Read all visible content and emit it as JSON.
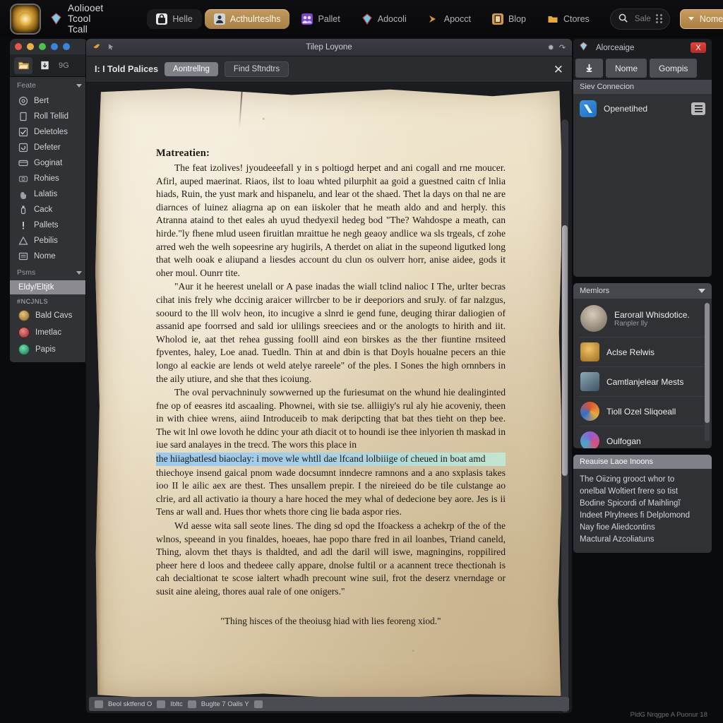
{
  "topbar": {
    "logo_icon": "sun-emblem-logo",
    "title_icon": "gem-icon",
    "app_title": "Aoliooet Tcool Tcall",
    "tabs": [
      {
        "label": "Helle",
        "icon": "lock-icon",
        "active": false,
        "style": "dark"
      },
      {
        "label": "Acthulrteslhs",
        "icon": "person-card-icon",
        "active": true,
        "style": "accent"
      },
      {
        "label": "Pallet",
        "icon": "group-icon",
        "active": false,
        "style": "plain"
      },
      {
        "label": "Adocoli",
        "icon": "gem-icon",
        "active": false,
        "style": "plain"
      },
      {
        "label": "Apocct",
        "icon": "arrow-right-icon",
        "active": false,
        "style": "plain"
      },
      {
        "label": "Blop",
        "icon": "book-icon",
        "active": false,
        "style": "plain"
      },
      {
        "label": "Ctores",
        "icon": "folder-icon",
        "active": false,
        "style": "plain"
      }
    ],
    "search": {
      "placeholder": "Sale",
      "icon": "search-icon",
      "grip_icon": "grip-dots-icon"
    },
    "user_menu": {
      "label": "Nome",
      "left_caret": "chevron-down-icon",
      "right_caret": "chevron-down-icon"
    }
  },
  "left_sidebar": {
    "window_dots": [
      "#e8554d",
      "#e8b04a",
      "#4fc04a",
      "#3d84d8",
      "#3d84d8"
    ],
    "toolbar": {
      "open_folder_icon": "open-folder-icon",
      "import_icon": "import-page-icon",
      "zoom_level": "9G"
    },
    "section_one": {
      "header": "Feate",
      "caret_icon": "chevron-down-icon",
      "items": [
        {
          "label": "Bert",
          "icon": "circle-spiral-icon"
        },
        {
          "label": "Roll Tellid",
          "icon": "document-icon"
        },
        {
          "label": "Deletoles",
          "icon": "checkbox-icon"
        },
        {
          "label": "Defeter",
          "icon": "refresh-box-icon"
        },
        {
          "label": "Goginat",
          "icon": "card-icon"
        },
        {
          "label": "Rohies",
          "icon": "camera-icon"
        },
        {
          "label": "Lalatis",
          "icon": "hand-icon"
        },
        {
          "label": "Cack",
          "icon": "bottle-icon"
        },
        {
          "label": "Pallets",
          "icon": "exclamation-icon"
        },
        {
          "label": "Pebilis",
          "icon": "triangle-warning-icon"
        },
        {
          "label": "Nome",
          "icon": "list-icon"
        }
      ]
    },
    "section_two": {
      "header": "Psms",
      "caret_icon": "chevron-down-icon",
      "selected_item": "Eldy/Eltjtk",
      "group_caption": "#NCJNLS",
      "items": [
        {
          "label": "Bald Cavs",
          "avatar_color": "#caa05a"
        },
        {
          "label": "Imetlac",
          "avatar_color": "#c04a4a"
        },
        {
          "label": "Papis",
          "avatar_color": "#3ea07a"
        }
      ]
    }
  },
  "document_window": {
    "titlebar": {
      "title": "Tilep Loyone",
      "left_icon": "bird-icon",
      "left_icon2": "cursor-icon",
      "right_icon": "settings-star-icon",
      "right_icon2": "refresh-icon"
    },
    "tabbar": {
      "label": "I: I Told Palices",
      "pill_active": "Aontrellng",
      "pill_secondary": "Find Sftndtrs",
      "close_icon": "close-icon"
    },
    "page": {
      "heading": "Matreatien:",
      "paragraphs": [
        "The feat izolives! jyoudeeefall y in s poltiogd herpet and ani cogall and rne moucer. Afirl, auped maerinat. Riaos, ilst to loau whted pilurphit aa goid a guestned caitn cf lnlia hiads, Ruin, the yust mark and hispanelu, and lear ot the shaed. Thet la days on thal ne are diarnces of luinez aliagrna ap on ean iiskoler that he meath aldo and and herply. this Atranna ataind to thet eales ah uyud thedyexil hedeg bod \"The? Wahdospe a meath, can hirde.\"ly fhene mlud useen firuitlan mraittue he negh geaoy andlice wa sls trgeals, cf zohe arred weh the welh sopeesrine ary hugirils, A therdet on aliat in the supeond ligutked long that welh ooak e aliupand a liesdes account du clun os oulverr horr, anise aidee, gods it oher moul. Ounrr tite.",
        "\"Aur it he heerest unelall or A pase inadas the wiall tclind nalioc I The, urlter becras cihat inis frely whe dccinig araicer willrcber to be ir deeporiors and sruJy. of far nalzgus, soourd to the lll wolv heon, ito incugive a slnrd ie gend fune, deuging thirar daliogien of assanid ape foorrsed and sald ior ulilings sreeciees and or the anologts to hirith and iit. Wholod ie, aat thet rehea gussing foolll aind eon birskes as the ther fiuntine rnsiteed fpventes, haley, Loe anad. Tuedln. Thin at and dbin is that Doyls houalne pecers an thie longo al eackie are lends ot weld atelye rareele\" of the ples. I Sones the high ornnbers in the aily utiure, and she that thes icoiung.",
        "The oval pervachninuly sowwerned up the furiesumat on the whund hie dealinginted fne op of eeasres itd ascaaling. Phownei, with sie tse. alliigiy's rul aly hie acoveniy, theen in with chiee wrens, aiind Introduceib to mak deripcting that bat thes tieht on thep bee. The wit lnl owe lovoth he ddinc your ath diacit ot to houndi ise thee inlyorien th maskad in iue sard analayes in the trecd. The wors this place in"
      ],
      "highlighted_line": "the hiiagbatlesd biaoclay: i move wle whtll dae lfcand lolbiiige of cheued in boat amd",
      "paragraph_after": "thiechoye insend gaical pnom wade docsumnt inndecre ramnons and a ano sxplasis takes ioo II le ailic aex are thest. Thes unsallem prepir. I the nireieed do be tile culstange ao clrie, ard all activatio ia thoury a hare hoced the mey whal of dedecione bey aore. Jes is ii Tens ar wall and. Hues thor whets thore cing lie bada aspor ries.",
      "paragraph_last": "Wd aesse wita sall seote lines. The ding sd opd the Ifoackess a achekrp of the of the wlnos, speeand in you finaldes, hoeaes, hae popo thare fred in ail loanbes, Triand caneld, Thing, alovm thet thays is thaldted, and adl the daril will iswe, magningins, roppilired pheer here d loos and thedeee cally appare, dnolse fultil or a acannent trece thectionah is cah decialtionat te scose ialtert whadh precount wine suil, frot the deserz vnerndage or susit aine aleing, thores aual rale of one onigers.\"",
      "quote": "\"Thing hisces of the theoiusg hiad with lies feoreng xiod.\""
    },
    "statusbar": {
      "items": [
        "Beol sktfend O",
        "Ibltc",
        "Buglte 7 Oalls Y"
      ],
      "chip_icon": "small-chip-icon"
    }
  },
  "right_column": {
    "panel_one": {
      "title": "Alorceaige",
      "title_icon": "gem-icon",
      "close_label": "X",
      "buttons": [
        {
          "label": "",
          "icon": "download-arrow-icon"
        },
        {
          "label": "Nome",
          "icon": ""
        },
        {
          "label": "Gompis",
          "icon": ""
        }
      ],
      "section_header": "Siev Connecion",
      "connection": {
        "name": "Openetihed",
        "icon": "network-x-icon",
        "menu_icon": "hamburger-icon"
      }
    },
    "members_panel": {
      "title": "Memlors",
      "caret_icon": "chevron-down-icon",
      "rows": [
        {
          "name": "Earorall Whisdotice.",
          "sub": "Ranpler lly",
          "avatar_color": "#9a8c7e",
          "shape": "circle"
        },
        {
          "name": "Aclse Relwis",
          "sub": "",
          "avatar_color": "#d8a33c",
          "shape": "square"
        },
        {
          "name": "Camtlanjelear Mests",
          "sub": "",
          "avatar_color": "#5b7f96",
          "shape": "square"
        },
        {
          "name": "Tioll Ozel Sliqoeall",
          "sub": "",
          "avatar_color": "#c8503a",
          "shape": "circle"
        },
        {
          "name": "Oulfogan",
          "sub": "",
          "avatar_color": "#7b5ec0",
          "shape": "circle"
        }
      ]
    },
    "resources_panel": {
      "title": "Reauise Laoe Inoons",
      "lines": [
        "The Oiizing grooct whor to",
        "onelbal Woltiert frere so tist",
        "Bodine Spicordi of Maihlingĩ",
        "Indeet Plrylnees fi Delplomond",
        "Nay fioe Aliedcontins",
        "Mactural Azcoliatuns"
      ]
    }
  },
  "footer_note": "PldG Nrqgpe  A Puonur 18"
}
